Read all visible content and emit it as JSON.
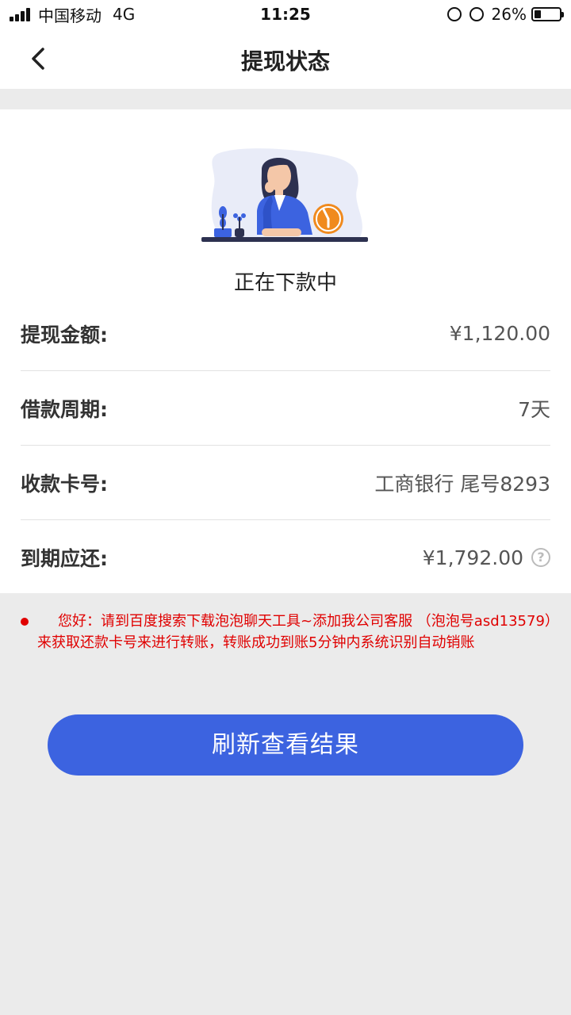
{
  "status_bar": {
    "carrier": "中国移动",
    "network": "4G",
    "time": "11:25",
    "battery": "26%"
  },
  "nav": {
    "title": "提现状态",
    "back_icon": "chevron-left-icon"
  },
  "status": {
    "text": "正在下款中"
  },
  "info": {
    "amount_label": "提现金额:",
    "amount_value": "¥1,120.00",
    "period_label": "借款周期:",
    "period_value": "7天",
    "card_label": "收款卡号:",
    "card_value": "工商银行 尾号8293",
    "due_label": "到期应还:",
    "due_value": "¥1,792.00",
    "help_icon": "question-circle-icon"
  },
  "notice": {
    "text": "您好：请到百度搜索下载泡泡聊天工具~添加我公司客服 （泡泡号asd13579）来获取还款卡号来进行转账，转账成功到账5分钟内系统识别自动销账"
  },
  "button": {
    "label": "刷新查看结果"
  },
  "colors": {
    "accent": "#3c63e0",
    "notice": "#e00000",
    "clock": "#f08a1e"
  }
}
